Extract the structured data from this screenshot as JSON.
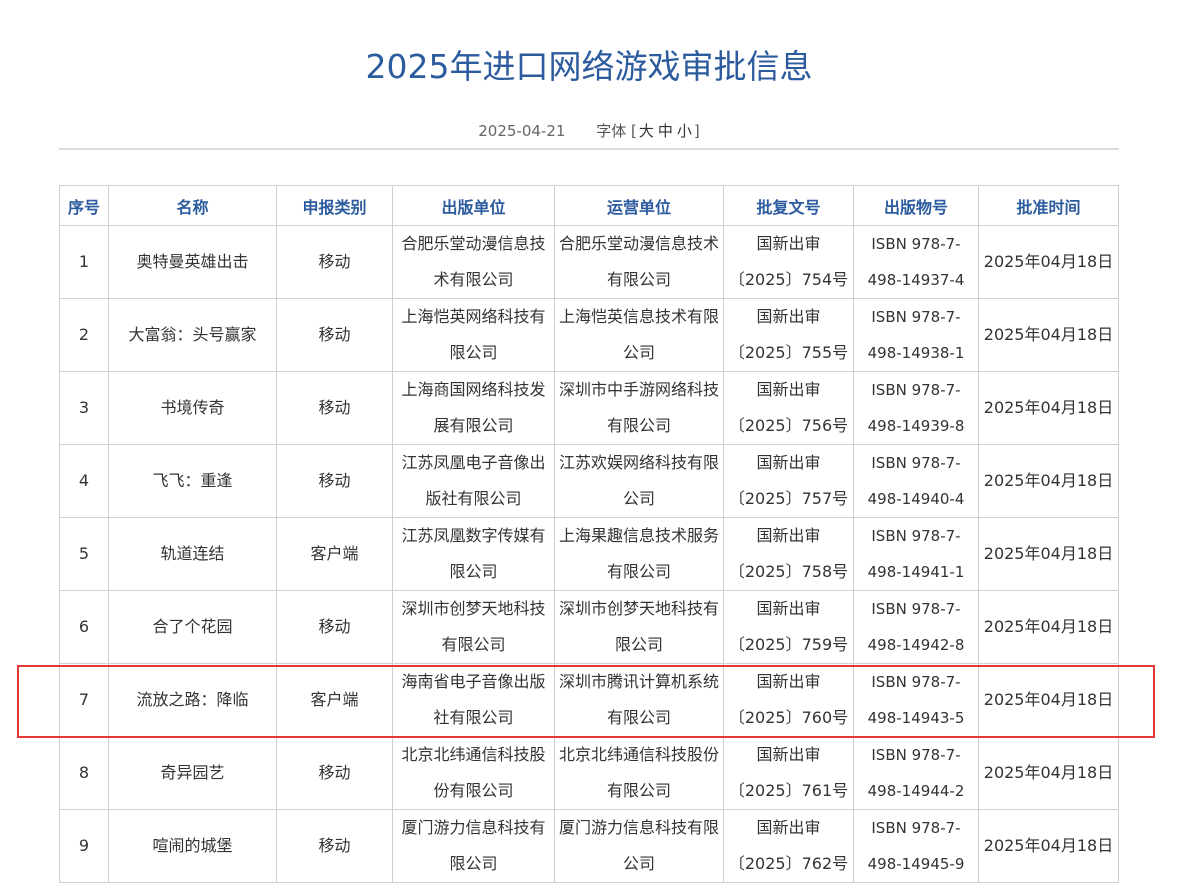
{
  "page": {
    "title": "2025年进口网络游戏审批信息",
    "date": "2025-04-21",
    "font_size_label": "字体",
    "font_size_open": "[",
    "font_size_options": [
      "大",
      "中",
      "小"
    ],
    "font_size_close": "]"
  },
  "table": {
    "headers": [
      "序号",
      "名称",
      "申报类别",
      "出版单位",
      "运营单位",
      "批复文号",
      "出版物号",
      "批准时间"
    ],
    "rows": [
      [
        "1",
        "奥特曼英雄出击",
        "移动",
        "合肥乐堂动漫信息技术有限公司",
        "合肥乐堂动漫信息技术有限公司",
        "国新出审〔2025〕754号",
        "ISBN 978-7-498-14937-4",
        "2025年04月18日"
      ],
      [
        "2",
        "大富翁：头号赢家",
        "移动",
        "上海恺英网络科技有限公司",
        "上海恺英信息技术有限公司",
        "国新出审〔2025〕755号",
        "ISBN 978-7-498-14938-1",
        "2025年04月18日"
      ],
      [
        "3",
        "书境传奇",
        "移动",
        "上海商国网络科技发展有限公司",
        "深圳市中手游网络科技有限公司",
        "国新出审〔2025〕756号",
        "ISBN 978-7-498-14939-8",
        "2025年04月18日"
      ],
      [
        "4",
        "飞飞：重逢",
        "移动",
        "江苏凤凰电子音像出版社有限公司",
        "江苏欢娱网络科技有限公司",
        "国新出审〔2025〕757号",
        "ISBN 978-7-498-14940-4",
        "2025年04月18日"
      ],
      [
        "5",
        "轨道连结",
        "客户端",
        "江苏凤凰数字传媒有限公司",
        "上海果趣信息技术服务有限公司",
        "国新出审〔2025〕758号",
        "ISBN 978-7-498-14941-1",
        "2025年04月18日"
      ],
      [
        "6",
        "合了个花园",
        "移动",
        "深圳市创梦天地科技有限公司",
        "深圳市创梦天地科技有限公司",
        "国新出审〔2025〕759号",
        "ISBN 978-7-498-14942-8",
        "2025年04月18日"
      ],
      [
        "7",
        "流放之路：降临",
        "客户端",
        "海南省电子音像出版社有限公司",
        "深圳市腾讯计算机系统有限公司",
        "国新出审〔2025〕760号",
        "ISBN 978-7-498-14943-5",
        "2025年04月18日"
      ],
      [
        "8",
        "奇异园艺",
        "移动",
        "北京北纬通信科技股份有限公司",
        "北京北纬通信科技股份有限公司",
        "国新出审〔2025〕761号",
        "ISBN 978-7-498-14944-2",
        "2025年04月18日"
      ],
      [
        "9",
        "喧闹的城堡",
        "移动",
        "厦门游力信息科技有限公司",
        "厦门游力信息科技有限公司",
        "国新出审〔2025〕762号",
        "ISBN 978-7-498-14945-9",
        "2025年04月18日"
      ]
    ]
  },
  "colors": {
    "title": "#2c5b9e",
    "header_text": "#2c5b9e",
    "highlight_border": "#e53935",
    "grid_border": "#cfcfcf"
  }
}
